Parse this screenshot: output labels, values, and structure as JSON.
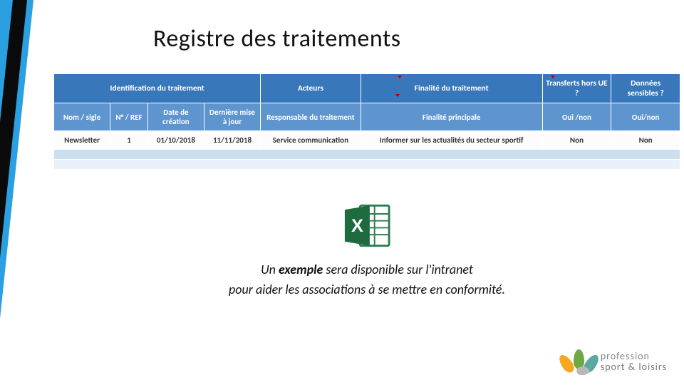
{
  "title": "Registre des traitements",
  "table": {
    "header1": {
      "ident": "Identification du traitement",
      "acteurs": "Acteurs",
      "finalite": "Finalité du traitement",
      "transfers": "Transferts hors UE ?",
      "sensibles": "Données sensibles ?"
    },
    "header2": {
      "nom": "Nom / sigle",
      "ref": "N° / REF",
      "datecrea": "Date de création",
      "maj": "Dernière mise à jour",
      "resp": "Responsable du traitement",
      "finpr": "Finalité principale",
      "ouinon1": "Oui /non",
      "ouinon2": "Oui/non"
    },
    "row": {
      "nom": "Newsletter",
      "ref": "1",
      "datecrea": "01/10/2018",
      "maj": "11/11/2018",
      "resp": "Service communication",
      "finpr": "Informer sur les actualités du secteur sportif",
      "ouinon1": "Non",
      "ouinon2": "Non"
    }
  },
  "caption": {
    "line1a": "Un ",
    "line1b": "exemple",
    "line1c": " sera disponible sur l'intranet",
    "line2": "pour aider les associations à se mettre en conformité."
  },
  "logo": {
    "l1": "profession",
    "l2": "sport & loisirs"
  },
  "colors": {
    "petal_orange": "#f7a823",
    "petal_green": "#6fa742",
    "petal_teal": "#5aa8a0",
    "petal_grey": "#b7b8b9"
  }
}
